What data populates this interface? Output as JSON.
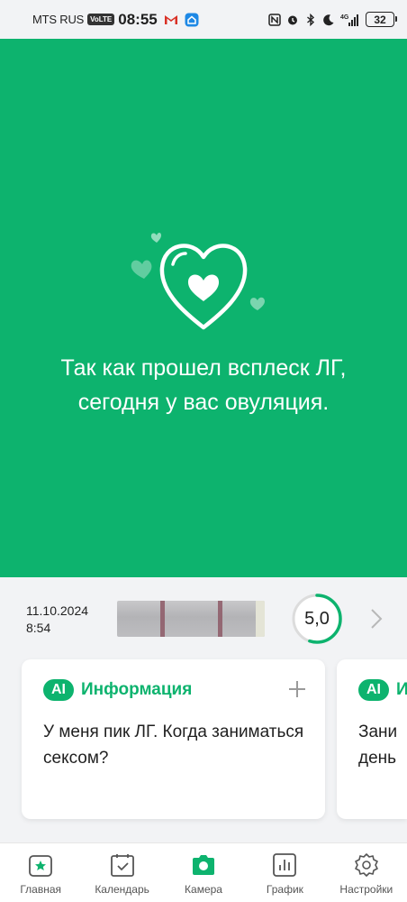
{
  "status_bar": {
    "carrier": "MTS RUS",
    "volte": "VoLTE",
    "time": "08:55",
    "network": "4G",
    "battery": "32"
  },
  "hero": {
    "message": "Так как прошел всплеск ЛГ, сегодня у вас овуляция.",
    "background_color": "#0db36e"
  },
  "result": {
    "date": "11.10.2024",
    "time": "8:54",
    "lh_value": "5,0",
    "lh_level": 0.55
  },
  "cards": [
    {
      "badge": "AI",
      "title": "Информация",
      "question": "У меня пик ЛГ. Когда заниматься сексом?"
    },
    {
      "badge": "AI",
      "title": "Информация",
      "question_partial_line1": "Зани",
      "question_partial_line2": "день"
    }
  ],
  "bottom_nav": {
    "items": [
      {
        "label": "Главная",
        "icon": "home-star-icon",
        "active": true
      },
      {
        "label": "Календарь",
        "icon": "calendar-check-icon",
        "active": false
      },
      {
        "label": "Камера",
        "icon": "camera-icon",
        "active": false
      },
      {
        "label": "График",
        "icon": "chart-icon",
        "active": false
      },
      {
        "label": "Настройки",
        "icon": "gear-icon",
        "active": false
      }
    ]
  },
  "colors": {
    "accent": "#0db36e",
    "background": "#f2f3f5"
  }
}
